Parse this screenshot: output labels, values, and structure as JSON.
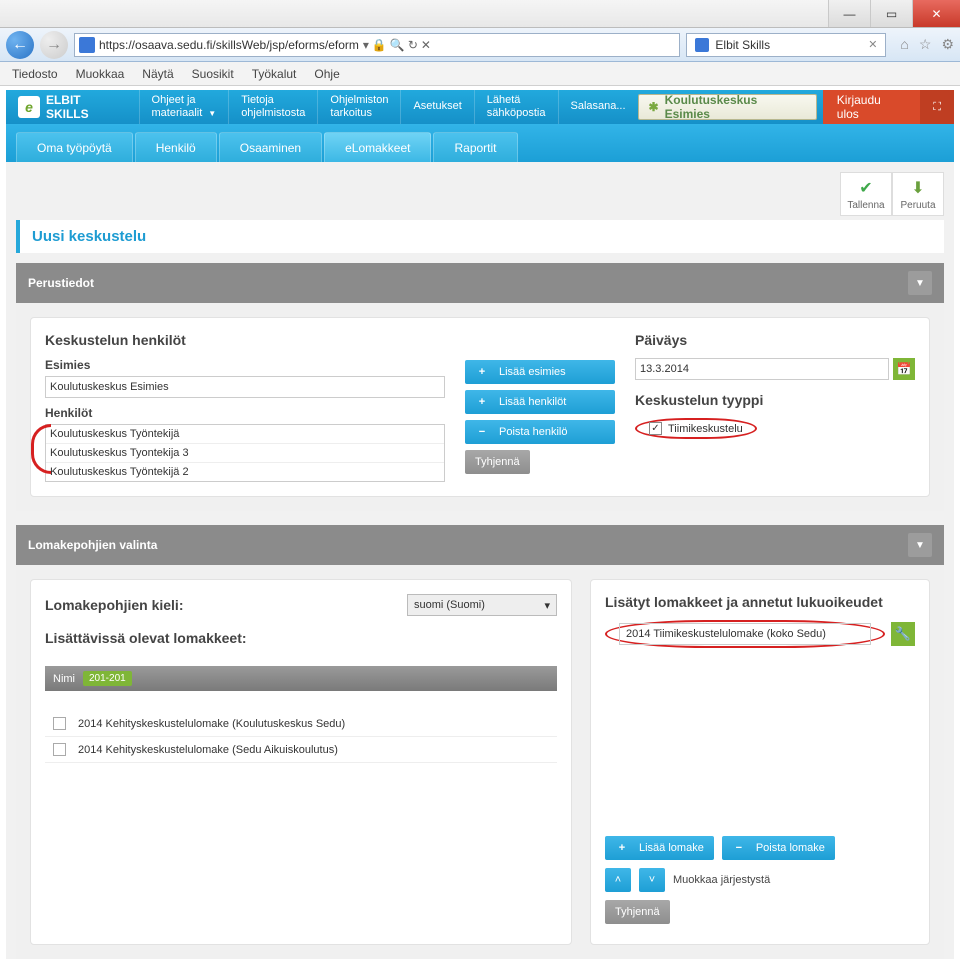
{
  "window": {
    "min": "—",
    "max": "▭",
    "close": "✕"
  },
  "browser": {
    "url": "https://osaava.sedu.fi/skillsWeb/jsp/eforms/eform",
    "lock": "🔒",
    "reload": "↻",
    "stop": "✕",
    "tab_title": "Elbit Skills",
    "menus": [
      "Tiedosto",
      "Muokkaa",
      "Näytä",
      "Suosikit",
      "Työkalut",
      "Ohje"
    ]
  },
  "topnav": {
    "app": "ELBIT SKILLS",
    "items": [
      {
        "l1": "Ohjeet ja",
        "l2": "materiaalit",
        "caret": true
      },
      {
        "l1": "Tietoja",
        "l2": "ohjelmistosta"
      },
      {
        "l1": "Ohjelmiston",
        "l2": "tarkoitus"
      },
      {
        "l1": "Asetukset"
      },
      {
        "l1": "Lähetä",
        "l2": "sähköpostia"
      },
      {
        "l1": "Salasana..."
      }
    ],
    "user": "Koulutuskeskus Esimies",
    "logout": "Kirjaudu ulos"
  },
  "subnav": [
    "Oma työpöytä",
    "Henkilö",
    "Osaaminen",
    "eLomakkeet",
    "Raportit"
  ],
  "subnav_active": 3,
  "actions": {
    "save": "Tallenna",
    "cancel": "Peruuta"
  },
  "page_title": "Uusi keskustelu",
  "sec1": {
    "header": "Perustiedot",
    "persons_title": "Keskustelun henkilöt",
    "supervisor_label": "Esimies",
    "supervisor_value": "Koulutuskeskus Esimies",
    "persons_label": "Henkilöt",
    "persons": [
      "Koulutuskeskus Työntekijä",
      "Koulutuskeskus Tyontekija 3",
      "Koulutuskeskus Työntekijä 2"
    ],
    "btn_add_sup": "Lisää esimies",
    "btn_add_per": "Lisää henkilöt",
    "btn_del_per": "Poista henkilö",
    "btn_clear": "Tyhjennä",
    "date_label": "Päiväys",
    "date_value": "13.3.2014",
    "type_label": "Keskustelun tyyppi",
    "team_chk": "Tiimikeskustelu"
  },
  "sec2": {
    "header": "Lomakepohjien valinta",
    "lang_label": "Lomakepohjien kieli:",
    "lang_value": "suomi (Suomi)",
    "avail_label": "Lisättävissä olevat lomakkeet:",
    "col_name": "Nimi",
    "range": "201-201",
    "forms": [
      "2014 Kehityskeskustelulomake (Koulutuskeskus Sedu)",
      "2014 Kehityskeskustelulomake (Sedu Aikuiskoulutus)"
    ],
    "added_label": "Lisätyt lomakkeet ja annetut lukuoikeudet",
    "added_item": "2014 Tiimikeskustelulomake (koko Sedu)",
    "btn_add": "Lisää lomake",
    "btn_del": "Poista lomake",
    "order_label": "Muokkaa järjestystä",
    "btn_clear": "Tyhjennä"
  }
}
